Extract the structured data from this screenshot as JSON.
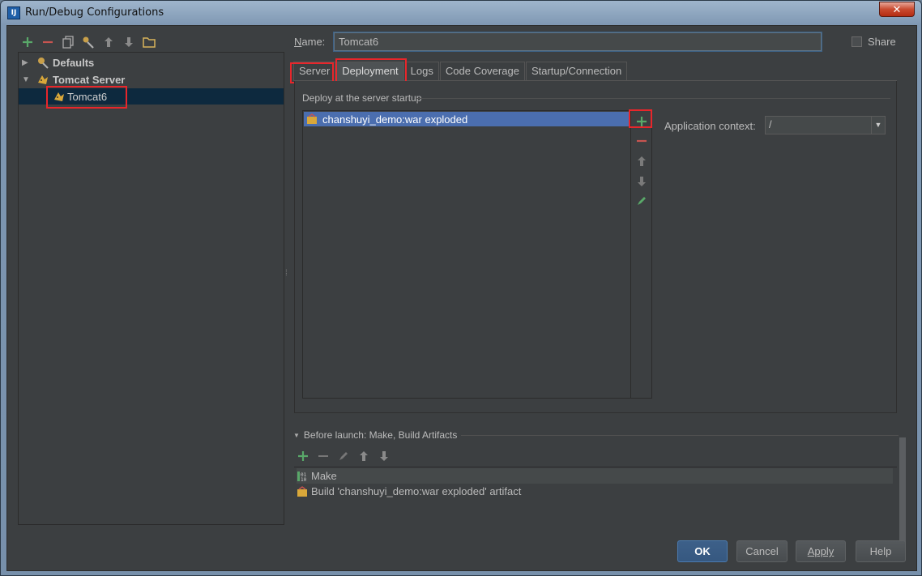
{
  "window": {
    "title": "Run/Debug Configurations",
    "app_icon_text": "IJ",
    "close_glyph": "✕"
  },
  "left_toolbar": {
    "icons": [
      "add-icon",
      "remove-icon",
      "copy-icon",
      "edit-defaults-icon",
      "move-up-icon",
      "move-down-icon",
      "folder-icon"
    ]
  },
  "tree": {
    "defaults_label": "Defaults",
    "tomcat_server_label": "Tomcat Server",
    "tomcat6_label": "Tomcat6"
  },
  "name_field": {
    "label_underlined": "N",
    "label_rest": "ame:",
    "value": "Tomcat6"
  },
  "share": {
    "label": "Share",
    "checked": false
  },
  "tabs": [
    {
      "label": "Server"
    },
    {
      "label": "Deployment",
      "active": true
    },
    {
      "label": "Logs"
    },
    {
      "label": "Code Coverage"
    },
    {
      "label": "Startup/Connection"
    }
  ],
  "deployment": {
    "section_title": "Deploy at the server startup",
    "items": [
      "chanshuyi_demo:war exploded"
    ],
    "app_context_label": "Application context:",
    "app_context_value": "/"
  },
  "before_launch": {
    "title": "Before launch: Make, Build Artifacts",
    "items": [
      "Make",
      "Build 'chanshuyi_demo:war exploded' artifact"
    ]
  },
  "buttons": {
    "ok": "OK",
    "cancel": "Cancel",
    "apply": "Apply",
    "help": "Help"
  },
  "colors": {
    "background": "#3c3f41",
    "selection": "#4b6eaf",
    "highlight_box": "#e8262b",
    "add_green": "#59a869",
    "remove_red": "#c75450"
  }
}
